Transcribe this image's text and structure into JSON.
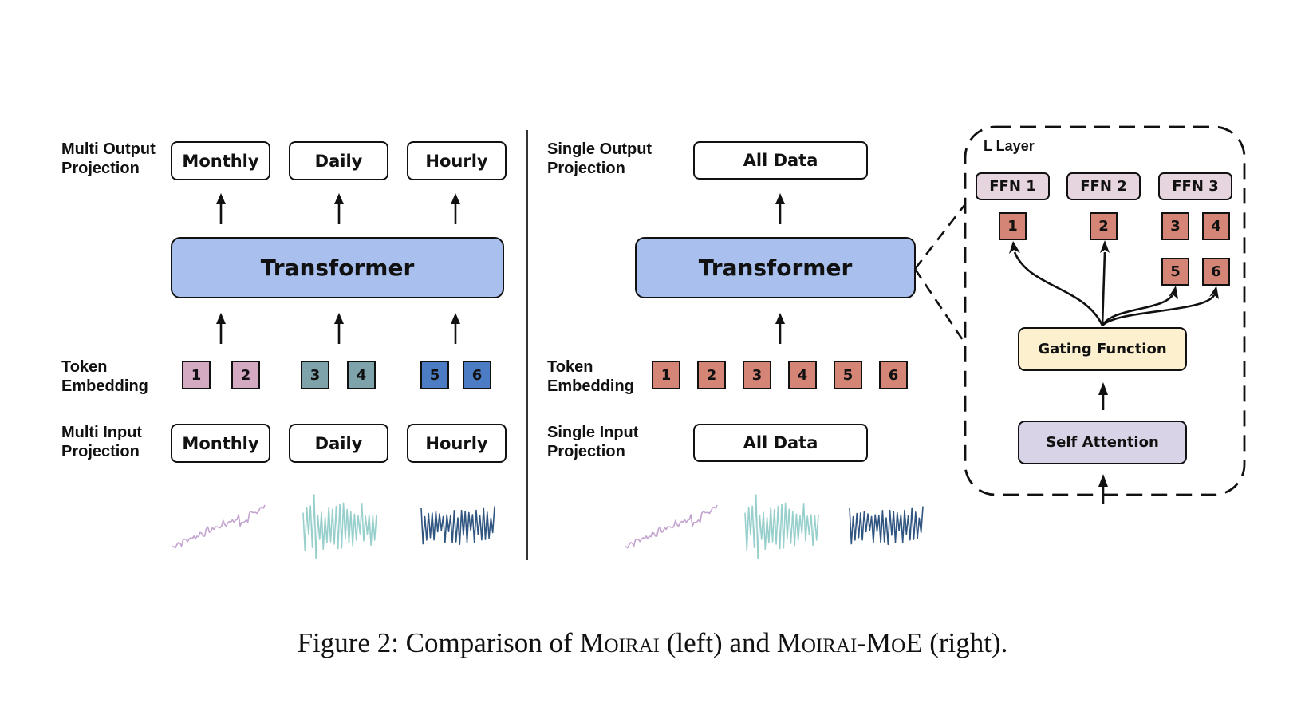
{
  "left": {
    "output_label": [
      "Multi Output",
      "Projection"
    ],
    "outputs": [
      "Monthly",
      "Daily",
      "Hourly"
    ],
    "transformer": "Transformer",
    "token_label": [
      "Token",
      "Embedding"
    ],
    "tokens": [
      {
        "label": "1",
        "color": "#d4a9c2"
      },
      {
        "label": "2",
        "color": "#d4a9c2"
      },
      {
        "label": "3",
        "color": "#7fa3aa"
      },
      {
        "label": "4",
        "color": "#7fa3aa"
      },
      {
        "label": "5",
        "color": "#4c7cc4"
      },
      {
        "label": "6",
        "color": "#4c7cc4"
      }
    ],
    "input_label": [
      "Multi Input",
      "Projection"
    ],
    "inputs": [
      "Monthly",
      "Daily",
      "Hourly"
    ],
    "series": [
      {
        "name": "monthly-series",
        "color": "#c3a3cf"
      },
      {
        "name": "daily-series",
        "color": "#97cfcc"
      },
      {
        "name": "hourly-series",
        "color": "#2f5580"
      }
    ]
  },
  "right": {
    "output_label": [
      "Single Output",
      "Projection"
    ],
    "output": "All Data",
    "transformer": "Transformer",
    "token_label": [
      "Token",
      "Embedding"
    ],
    "tokens": [
      "1",
      "2",
      "3",
      "4",
      "5",
      "6"
    ],
    "token_color": "#d48576",
    "input_label": [
      "Single Input",
      "Projection"
    ],
    "input": "All Data",
    "layer": {
      "title": "L Layer",
      "experts": [
        "FFN 1",
        "FFN 2",
        "FFN 3"
      ],
      "expert_color": "#e6d4de",
      "routed_tokens": [
        "1",
        "2",
        "3",
        "4",
        "5",
        "6"
      ],
      "gating": "Gating Function",
      "gating_color": "#fcf0cf",
      "attention": "Self Attention",
      "attention_color": "#d9d3e8"
    }
  },
  "colors": {
    "transformer": "#a9c0ee",
    "stroke": "#111111"
  },
  "caption": {
    "prefix": "Figure 2: Comparison of ",
    "model1": "Moirai",
    "mid": " (left) and ",
    "model2": "Moirai-MoE",
    "suffix": " (right)."
  }
}
